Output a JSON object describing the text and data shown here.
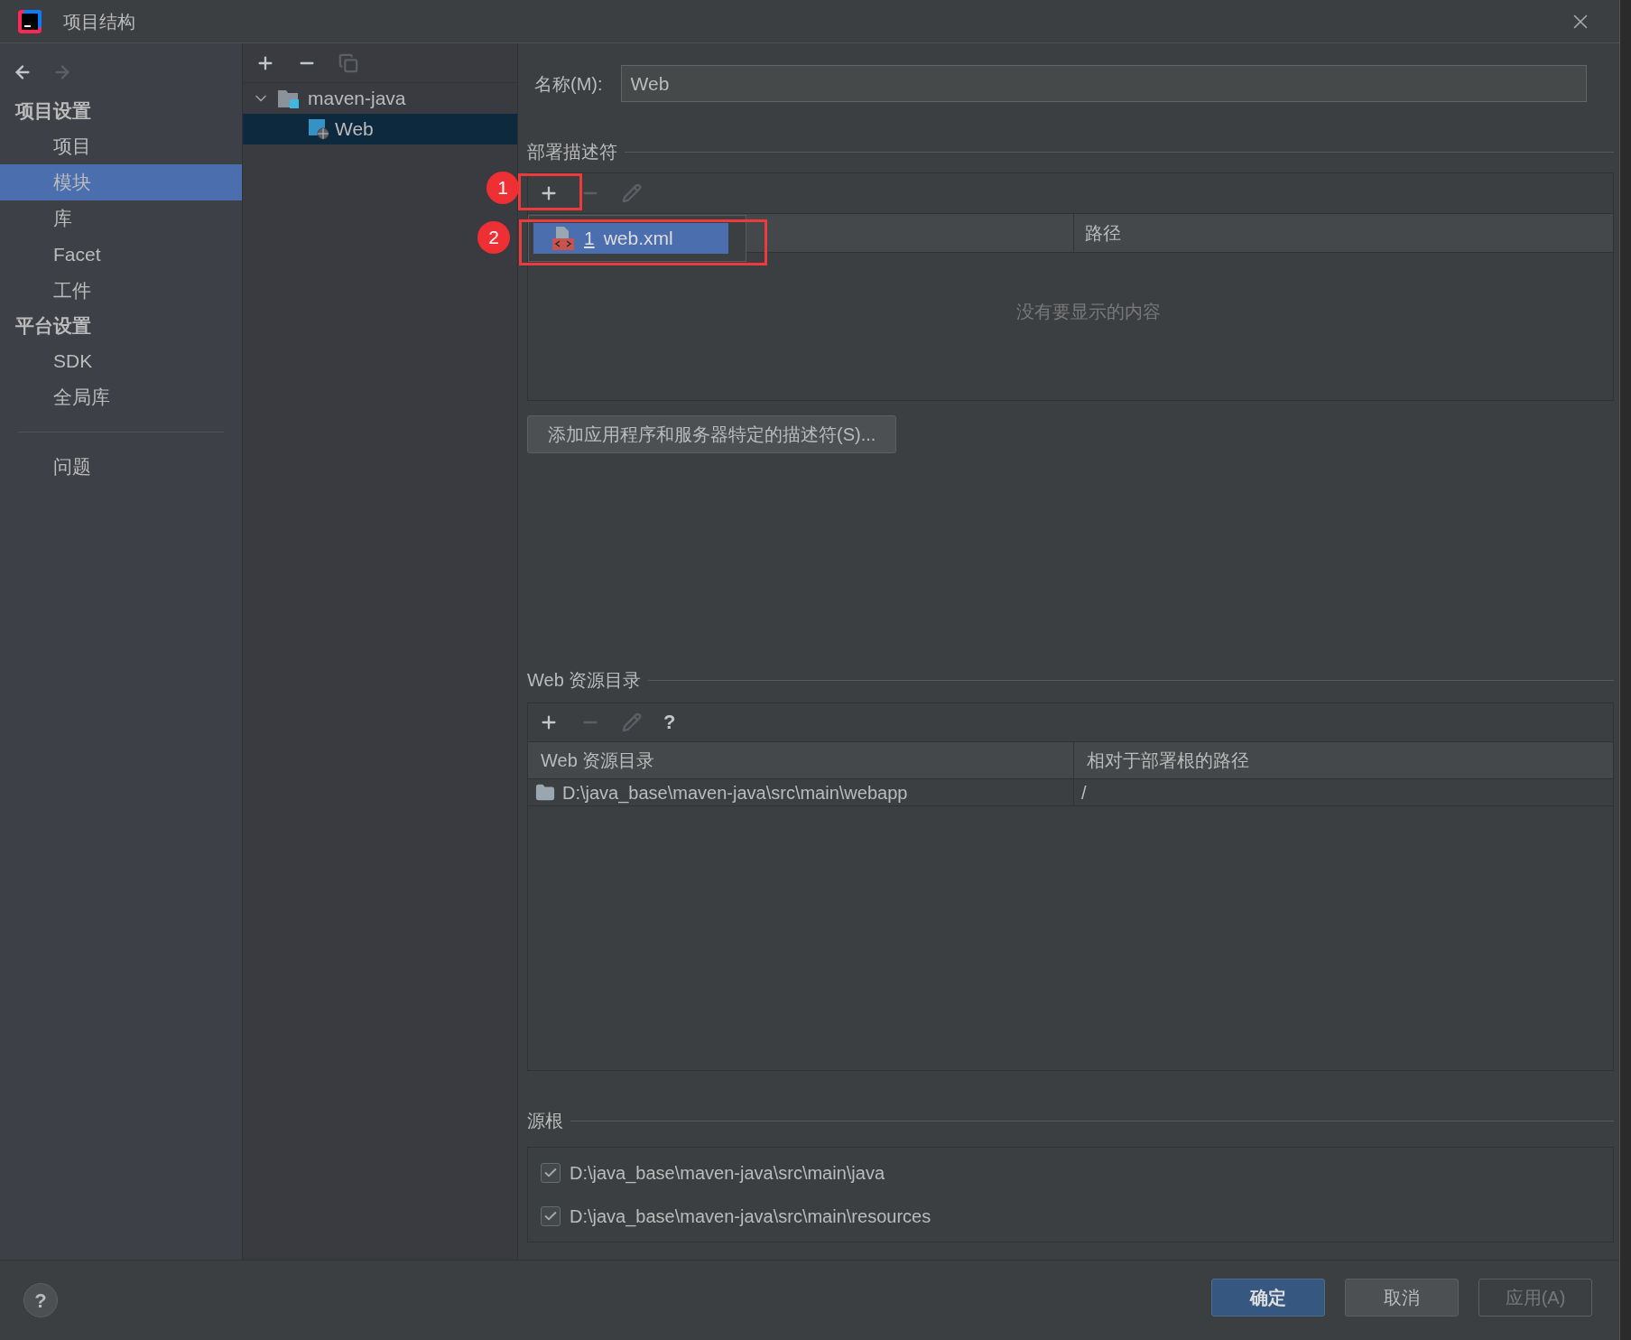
{
  "window": {
    "title": "项目结构"
  },
  "nav_tools": [
    {
      "kind": "back",
      "disabled": false
    },
    {
      "kind": "forward",
      "disabled": true
    }
  ],
  "nav": {
    "sections": [
      {
        "heading": "项目设置",
        "items": [
          {
            "label": "项目",
            "selected": false
          },
          {
            "label": "模块",
            "selected": true
          },
          {
            "label": "库",
            "selected": false
          },
          {
            "label": "Facet",
            "selected": false
          },
          {
            "label": "工件",
            "selected": false
          }
        ]
      },
      {
        "heading": "平台设置",
        "items": [
          {
            "label": "SDK",
            "selected": false
          },
          {
            "label": "全局库",
            "selected": false
          }
        ]
      }
    ],
    "problems": {
      "label": "问题",
      "selected": false
    }
  },
  "tree_tools": [
    {
      "kind": "add",
      "disabled": false
    },
    {
      "kind": "remove",
      "disabled": false
    },
    {
      "kind": "copy",
      "disabled": true
    }
  ],
  "tree": {
    "items": [
      {
        "label": "maven-java",
        "expanded": true,
        "selected": false,
        "children": [
          {
            "label": "Web",
            "selected": true
          }
        ]
      }
    ]
  },
  "name_field": {
    "label": "名称(M):",
    "value": "Web"
  },
  "deployment_descriptors": {
    "title": "部署描述符",
    "tools": [
      {
        "kind": "add",
        "disabled": false
      },
      {
        "kind": "remove",
        "disabled": true
      },
      {
        "kind": "edit",
        "disabled": true
      }
    ],
    "popup": {
      "items": [
        {
          "number": "1",
          "label": "web.xml",
          "selected": true
        }
      ]
    },
    "columns": {
      "column_2": "路径"
    },
    "empty_text": "没有要显示的内容",
    "add_button": "添加应用程序和服务器特定的描述符(S)..."
  },
  "web_resources": {
    "title": "Web 资源目录",
    "tools": [
      {
        "kind": "add",
        "disabled": false
      },
      {
        "kind": "remove",
        "disabled": true
      },
      {
        "kind": "edit",
        "disabled": true
      },
      {
        "kind": "help",
        "disabled": false,
        "label": "?"
      }
    ],
    "columns": [
      "Web 资源目录",
      "相对于部署根的路径"
    ],
    "rows": [
      {
        "directory": "D:\\java_base\\maven-java\\src\\main\\webapp",
        "path": "/"
      }
    ]
  },
  "source_roots": {
    "title": "源根",
    "items": [
      {
        "path": "D:\\java_base\\maven-java\\src\\main\\java",
        "checked": true
      },
      {
        "path": "D:\\java_base\\maven-java\\src\\main\\resources",
        "checked": true
      }
    ]
  },
  "annotations": [
    "1",
    "2"
  ],
  "help_button": "?",
  "buttons": [
    {
      "label": "确定",
      "kind": "primary"
    },
    {
      "label": "取消",
      "kind": "normal"
    },
    {
      "label": "应用(A)",
      "kind": "disabled"
    }
  ]
}
